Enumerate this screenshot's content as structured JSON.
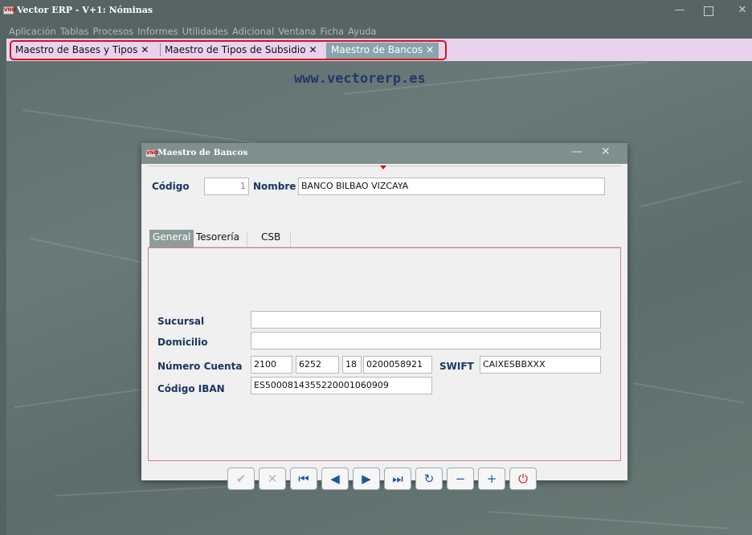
{
  "app": {
    "title": "Vector ERP - V+1: Nóminas",
    "logo": "VNO"
  },
  "menu": [
    "Aplicación",
    "Tablas",
    "Procesos",
    "Informes",
    "Utilidades",
    "Adicional",
    "Ventana",
    "Ficha",
    "Ayuda"
  ],
  "doc_tabs": [
    {
      "label": "Maestro de Bases y Tipos",
      "close": "✕"
    },
    {
      "label": "Maestro de Tipos de Subsidio",
      "close": "✕"
    },
    {
      "label": "Maestro de Bancos",
      "close": "✕"
    }
  ],
  "watermark": "www.vectorerp.es",
  "dialog": {
    "title": "Maestro de Bancos",
    "codigo_label": "Código",
    "codigo_value": "1",
    "nombre_label": "Nombre",
    "nombre_value": "BANCO BILBAO VIZCAYA",
    "tabs": [
      "General",
      "Tesorería",
      "CSB"
    ],
    "sucursal_label": "Sucursal",
    "sucursal_value": "",
    "domicilio_label": "Domicilio",
    "domicilio_value": "",
    "cuenta_label": "Número Cuenta",
    "cuenta_entidad": "2100",
    "cuenta_oficina": "6252",
    "cuenta_dc": "18",
    "cuenta_numero": "0200058921",
    "swift_label": "SWIFT",
    "swift_value": "CAIXESBBXXX",
    "iban_label": "Código IBAN",
    "iban_value": "ES5000814355220001060909"
  },
  "nav_buttons": [
    "check-icon",
    "cancel-icon",
    "first-record-icon",
    "previous-record-icon",
    "next-record-icon",
    "last-record-icon",
    "refresh-icon",
    "delete-record-icon",
    "add-record-icon",
    "power-icon"
  ],
  "colors": {
    "accent": "#d4131b",
    "label": "#1a3560",
    "title_bar": "#566564",
    "tab_strip": "#ead2ec"
  }
}
